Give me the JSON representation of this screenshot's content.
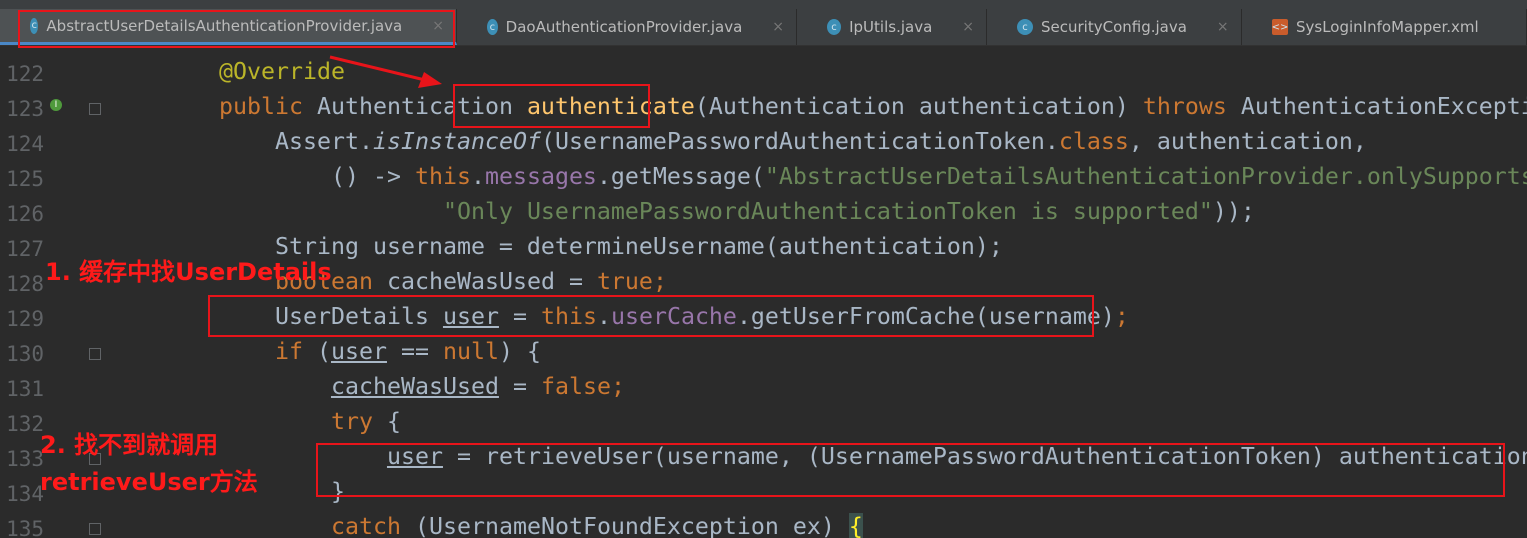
{
  "tabs": [
    {
      "label": "AbstractUserDetailsAuthenticationProvider.java",
      "icon": "class-icon",
      "active": true
    },
    {
      "label": "DaoAuthenticationProvider.java",
      "icon": "class-icon"
    },
    {
      "label": "IpUtils.java",
      "icon": "class-icon"
    },
    {
      "label": "SecurityConfig.java",
      "icon": "class-icon"
    },
    {
      "label": "SysLoginInfoMapper.xml",
      "icon": "xml-icon"
    }
  ],
  "close_glyph": "×",
  "lines": [
    {
      "n": "122",
      "t": [
        [
          "        ",
          ""
        ],
        [
          "@Override",
          "an"
        ]
      ]
    },
    {
      "n": "123",
      "t": [
        [
          "        ",
          ""
        ],
        [
          "public ",
          "kw"
        ],
        [
          "Authentication ",
          ""
        ],
        [
          "authenticate",
          "fn"
        ],
        [
          "(Authentication authentication) ",
          ""
        ],
        [
          "throws ",
          "kw"
        ],
        [
          "AuthenticationException {",
          ""
        ]
      ]
    },
    {
      "n": "124",
      "t": [
        [
          "            Assert.",
          ""
        ],
        [
          "isInstanceOf",
          "it"
        ],
        [
          "(UsernamePasswordAuthenticationToken.",
          ""
        ],
        [
          "class",
          "kw"
        ],
        [
          ", authentication,",
          ""
        ]
      ]
    },
    {
      "n": "125",
      "t": [
        [
          "                () -> ",
          ""
        ],
        [
          "this",
          "kw"
        ],
        [
          ".",
          ""
        ],
        [
          "messages",
          "fld"
        ],
        [
          ".getMessage(",
          ""
        ],
        [
          "\"AbstractUserDetailsAuthenticationProvider.onlySupports\"",
          "str"
        ],
        [
          ",",
          ""
        ]
      ]
    },
    {
      "n": "126",
      "t": [
        [
          "                        ",
          ""
        ],
        [
          "\"Only UsernamePasswordAuthenticationToken is supported\"",
          "str"
        ],
        [
          "));",
          ""
        ]
      ]
    },
    {
      "n": "127",
      "t": [
        [
          "            String username = determineUsername(authentication);",
          ""
        ]
      ]
    },
    {
      "n": "128",
      "t": [
        [
          "            ",
          ""
        ],
        [
          "boolean ",
          "kw"
        ],
        [
          "cacheWasUsed = ",
          ""
        ],
        [
          "true",
          "kw"
        ],
        [
          ";",
          "kw"
        ]
      ]
    },
    {
      "n": "129",
      "t": [
        [
          "            UserDetails ",
          ""
        ],
        [
          "user",
          "ul"
        ],
        [
          " = ",
          ""
        ],
        [
          "this",
          "kw"
        ],
        [
          ".",
          ""
        ],
        [
          "userCache",
          "fld"
        ],
        [
          ".getUserFromCache(username)",
          ""
        ],
        [
          ";",
          "kw"
        ]
      ]
    },
    {
      "n": "130",
      "t": [
        [
          "            ",
          ""
        ],
        [
          "if ",
          "kw"
        ],
        [
          "(",
          ""
        ],
        [
          "user",
          "ul"
        ],
        [
          " == ",
          ""
        ],
        [
          "null",
          "kw"
        ],
        [
          ") {",
          ""
        ]
      ]
    },
    {
      "n": "131",
      "t": [
        [
          "                ",
          ""
        ],
        [
          "cacheWasUsed",
          "ul"
        ],
        [
          " = ",
          ""
        ],
        [
          "false",
          "kw"
        ],
        [
          ";",
          "kw"
        ]
      ]
    },
    {
      "n": "132",
      "t": [
        [
          "                ",
          ""
        ],
        [
          "try ",
          "kw"
        ],
        [
          "{",
          ""
        ]
      ]
    },
    {
      "n": "133",
      "t": [
        [
          "                    ",
          ""
        ],
        [
          "user",
          "ul"
        ],
        [
          " = retrieveUser(username, (UsernamePasswordAuthenticationToken) authentication)",
          ""
        ],
        [
          ";",
          "kw"
        ]
      ]
    },
    {
      "n": "134",
      "t": [
        [
          "                }",
          ""
        ]
      ]
    },
    {
      "n": "135",
      "t": [
        [
          "                ",
          ""
        ],
        [
          "catch ",
          "kw"
        ],
        [
          "(UsernameNotFoundException ex) ",
          ""
        ],
        [
          "{",
          "br"
        ]
      ]
    }
  ],
  "annotations": {
    "step1": "1. 缓存中找UserDetails",
    "step2_line1": "2. 找不到就调用",
    "step2_line2": "retrieveUser方法",
    "color": "#e8141a"
  }
}
